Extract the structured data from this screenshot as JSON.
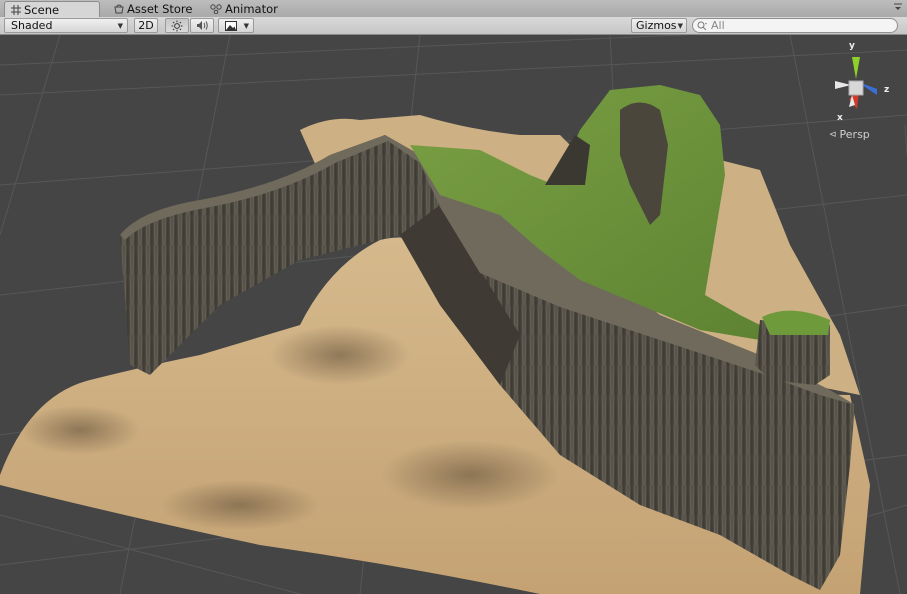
{
  "tabs": [
    {
      "label": "Scene",
      "icon": "scene-grid-icon",
      "active": true
    },
    {
      "label": "Asset Store",
      "icon": "store-icon",
      "active": false
    },
    {
      "label": "Animator",
      "icon": "animator-icon",
      "active": false
    }
  ],
  "toolbar": {
    "draw_mode": "Shaded",
    "mode_2d": "2D",
    "lighting_icon": "sun-icon",
    "audio_icon": "speaker-icon",
    "effects_icon": "image-icon",
    "gizmos_label": "Gizmos",
    "search_placeholder": "All"
  },
  "scene_gizmo": {
    "axis_y": "y",
    "axis_x": "x",
    "axis_z": "z",
    "projection": "Persp"
  },
  "colors": {
    "viewport_bg": "#454545",
    "grid_line": "#5a5a5a",
    "sand": "#c9ab80",
    "cliff": "#4f4a40",
    "grass": "#6a8f3a",
    "axis_x": "#d43a2a",
    "axis_y": "#8ed12a",
    "axis_z": "#3a6fd8"
  }
}
